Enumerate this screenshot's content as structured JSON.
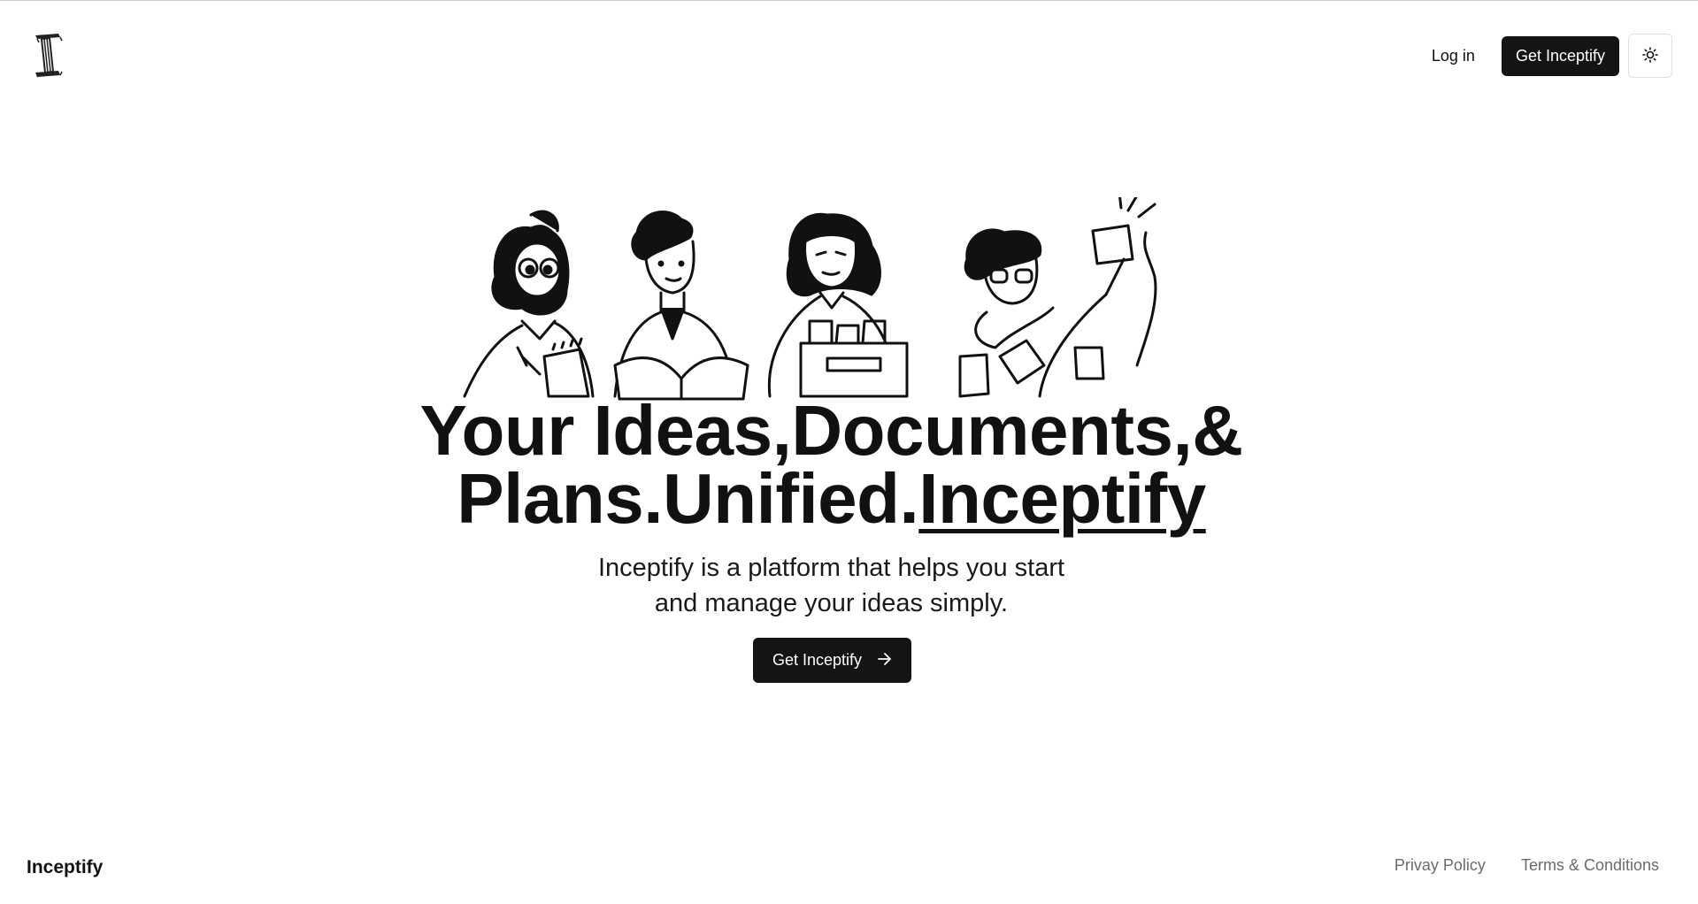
{
  "header": {
    "logo_icon": "inceptify-logo-icon",
    "login_label": "Log in",
    "get_label": "Get Inceptify",
    "theme_icon": "sun-icon"
  },
  "hero": {
    "illustration_icon": "people-working-illustration",
    "headline_line1": "Your Ideas,Documents,&",
    "headline_line2_plain": "Plans.Unified.",
    "headline_line2_brand": "Inceptify",
    "subtitle_line1": "Inceptify is a platform that helps you start",
    "subtitle_line2": "and manage your ideas simply.",
    "cta_label": "Get Inceptify",
    "cta_icon": "arrow-right-icon"
  },
  "footer": {
    "brand": "Inceptify",
    "links": [
      {
        "label": "Privay Policy"
      },
      {
        "label": "Terms & Conditions"
      }
    ]
  },
  "colors": {
    "primary": "#141414",
    "background": "#ffffff",
    "muted_text": "#6b6b6b"
  }
}
